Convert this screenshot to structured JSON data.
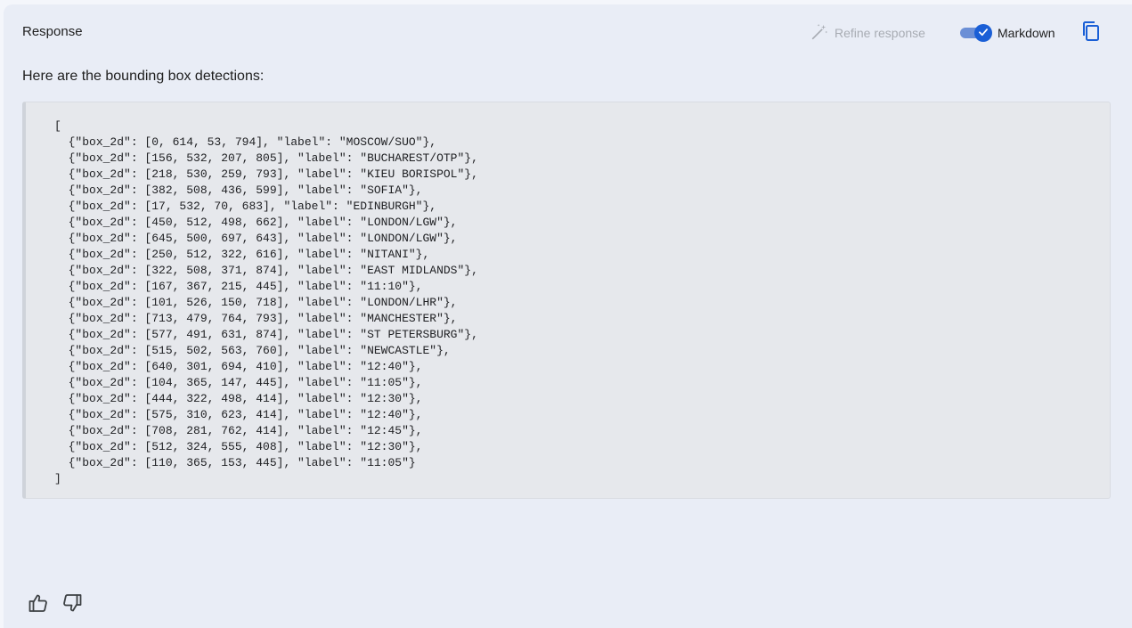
{
  "header": {
    "title": "Response",
    "refine_label": "Refine response",
    "markdown_label": "Markdown",
    "markdown_enabled": true
  },
  "intro_text": "Here are the bounding box detections:",
  "code": {
    "open": "[",
    "close": "]",
    "lines": [
      "{\"box_2d\": [0, 614, 53, 794], \"label\": \"MOSCOW/SUO\"},",
      "{\"box_2d\": [156, 532, 207, 805], \"label\": \"BUCHAREST/OTP\"},",
      "{\"box_2d\": [218, 530, 259, 793], \"label\": \"KIEU BORISPOL\"},",
      "{\"box_2d\": [382, 508, 436, 599], \"label\": \"SOFIA\"},",
      "{\"box_2d\": [17, 532, 70, 683], \"label\": \"EDINBURGH\"},",
      "{\"box_2d\": [450, 512, 498, 662], \"label\": \"LONDON/LGW\"},",
      "{\"box_2d\": [645, 500, 697, 643], \"label\": \"LONDON/LGW\"},",
      "{\"box_2d\": [250, 512, 322, 616], \"label\": \"NITANI\"},",
      "{\"box_2d\": [322, 508, 371, 874], \"label\": \"EAST MIDLANDS\"},",
      "{\"box_2d\": [167, 367, 215, 445], \"label\": \"11:10\"},",
      "{\"box_2d\": [101, 526, 150, 718], \"label\": \"LONDON/LHR\"},",
      "{\"box_2d\": [713, 479, 764, 793], \"label\": \"MANCHESTER\"},",
      "{\"box_2d\": [577, 491, 631, 874], \"label\": \"ST PETERSBURG\"},",
      "{\"box_2d\": [515, 502, 563, 760], \"label\": \"NEWCASTLE\"},",
      "{\"box_2d\": [640, 301, 694, 410], \"label\": \"12:40\"},",
      "{\"box_2d\": [104, 365, 147, 445], \"label\": \"11:05\"},",
      "{\"box_2d\": [444, 322, 498, 414], \"label\": \"12:30\"},",
      "{\"box_2d\": [575, 310, 623, 414], \"label\": \"12:40\"},",
      "{\"box_2d\": [708, 281, 762, 414], \"label\": \"12:45\"},",
      "{\"box_2d\": [512, 324, 555, 408], \"label\": \"12:30\"},",
      "{\"box_2d\": [110, 365, 153, 445], \"label\": \"11:05\"}"
    ]
  },
  "icons": {
    "refine": "magic-wand-icon",
    "copy": "copy-icon",
    "thumbs_up": "thumbs-up-icon",
    "thumbs_down": "thumbs-down-icon"
  },
  "colors": {
    "accent": "#1a5fd6",
    "panel_bg": "#e9edf6",
    "code_bg": "#e6e8ec"
  }
}
